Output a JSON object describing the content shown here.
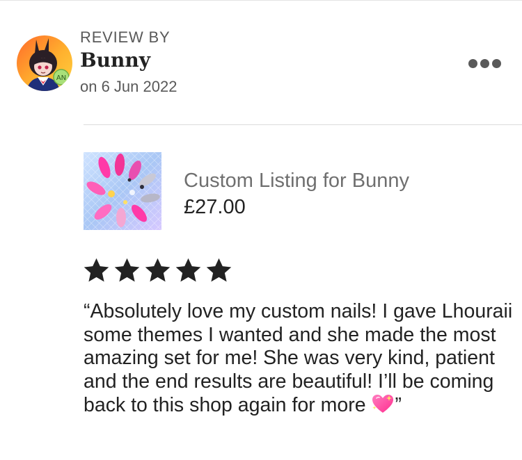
{
  "review": {
    "label": "REVIEW BY",
    "reviewer": "Bunny",
    "date": "on 6 Jun 2022",
    "rating": 5,
    "text_before_emoji": "“Absolutely love my custom nails! I gave Lhouraii some themes I wanted and she made the most amazing set for me! She was very kind, patient and the end results are beautiful! I’ll be coming back to this shop again for more ",
    "emoji_icon": "sparkling-heart-icon",
    "text_after_emoji": "”"
  },
  "listing": {
    "title": "Custom Listing for Bunny",
    "price": "£27.00"
  },
  "icons": {
    "avatar": "anime-bunny-avatar",
    "more": "more-options-icon",
    "star": "star-icon"
  },
  "colors": {
    "text_primary": "#222222",
    "text_secondary": "#595959",
    "star": "#222222",
    "heart": "#ff3f9a"
  }
}
